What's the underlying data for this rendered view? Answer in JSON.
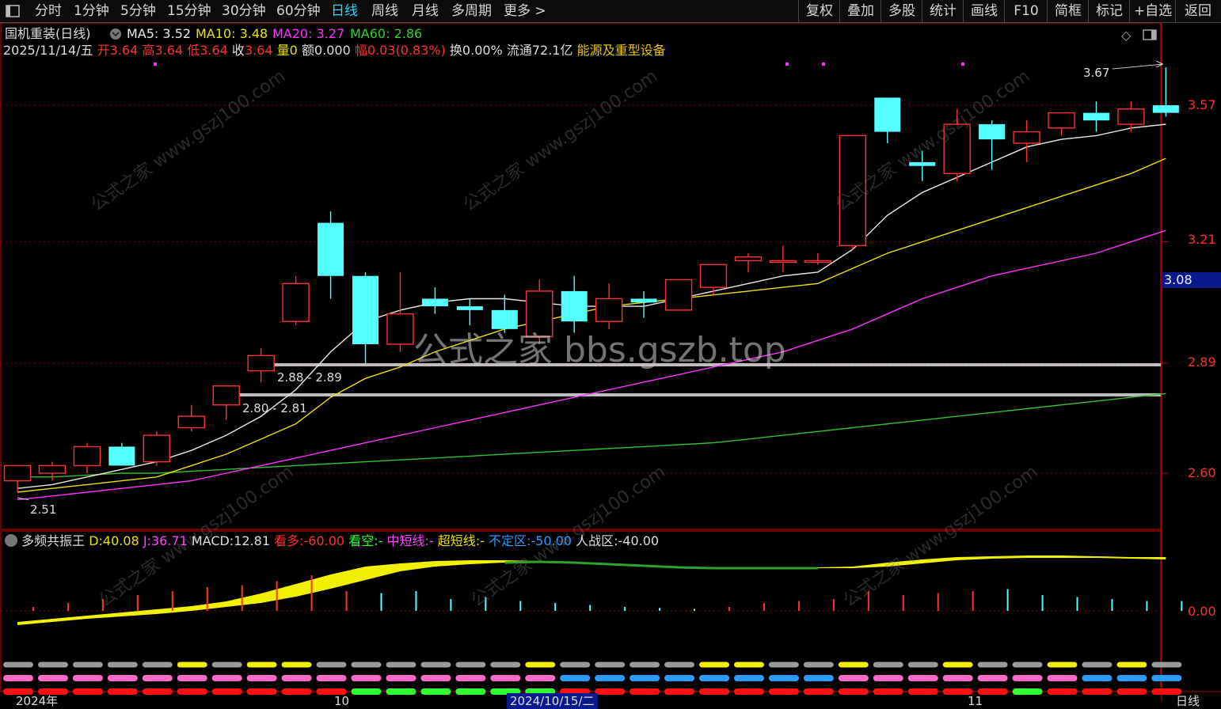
{
  "toolbar": {
    "periods": [
      "分时",
      "1分钟",
      "5分钟",
      "15分钟",
      "30分钟",
      "60分钟",
      "日线",
      "周线",
      "月线",
      "多周期",
      "更多"
    ],
    "active_period": "日线",
    "right": [
      "复权",
      "叠加",
      "多股",
      "统计",
      "画线",
      "F10",
      "简框",
      "标记",
      "+自选",
      "返回"
    ]
  },
  "stock": {
    "title": "国机重装(日线)",
    "ma5_label": "MA5:",
    "ma5": "3.52",
    "ma10_label": "MA10:",
    "ma10": "3.48",
    "ma20_label": "MA20:",
    "ma20": "3.27",
    "ma60_label": "MA60:",
    "ma60": "2.86"
  },
  "quote": {
    "date": "2025/11/14/五",
    "open_label": "开",
    "open": "3.64",
    "high_label": "高",
    "high": "3.64",
    "low_label": "低",
    "low": "3.64",
    "close_label": "收",
    "close": "3.64",
    "vol_label": "量",
    "vol": "0",
    "amount_label": "额",
    "amount": "0.000",
    "change_label": "幅",
    "change": "0.03(0.83%)",
    "turnover": "换0.00%",
    "float": "流通72.1亿",
    "industry": "能源及重型设备"
  },
  "price_axis": [
    "3.57",
    "3.21",
    "2.89",
    "2.60"
  ],
  "current_price": "3.08",
  "annotations": {
    "high_label": "3.67",
    "low_label": "2.51",
    "zone1": "2.88 - 2.89",
    "zone2": "2.80 - 2.81"
  },
  "watermark_center": "公式之家 bbs.gszb.top",
  "watermark_tile": "公式之家 www.gszj100.com",
  "indicator": {
    "name": "多频共振王",
    "d_label": "D:",
    "d": "40.08",
    "j_label": "J:",
    "j": "36.71",
    "macd_label": "MACD:",
    "macd": "12.81",
    "bull_label": "看多:",
    "bull": "-60.00",
    "bear_label": "看空:",
    "bear": "-",
    "mid_label": "中短线:",
    "mid": "-",
    "short_label": "超短线:",
    "short": "-",
    "uncertain_label": "不定区:",
    "uncertain": "-50.00",
    "battle_label": "人战区:",
    "battle": "-40.00",
    "axis": "0.00"
  },
  "bottom": {
    "year": "2024年",
    "m1": "10",
    "date_box": "2024/10/15/二",
    "m2": "11",
    "period": "日线"
  },
  "colors": {
    "up": "#ff3030",
    "down": "#54ffff",
    "ma5": "#e8e8e8",
    "ma10": "#e8e000",
    "ma20": "#ff30ff",
    "ma60": "#30c030"
  },
  "chart_data": {
    "type": "candlestick",
    "candles": [
      {
        "o": 2.58,
        "h": 2.62,
        "l": 2.55,
        "c": 2.62
      },
      {
        "o": 2.6,
        "h": 2.63,
        "l": 2.58,
        "c": 2.62
      },
      {
        "o": 2.62,
        "h": 2.68,
        "l": 2.6,
        "c": 2.67
      },
      {
        "o": 2.67,
        "h": 2.68,
        "l": 2.62,
        "c": 2.62
      },
      {
        "o": 2.63,
        "h": 2.71,
        "l": 2.62,
        "c": 2.7
      },
      {
        "o": 2.72,
        "h": 2.78,
        "l": 2.71,
        "c": 2.75
      },
      {
        "o": 2.78,
        "h": 2.83,
        "l": 2.74,
        "c": 2.83
      },
      {
        "o": 2.87,
        "h": 2.93,
        "l": 2.84,
        "c": 2.91
      },
      {
        "o": 3.0,
        "h": 3.12,
        "l": 2.99,
        "c": 3.1
      },
      {
        "o": 3.26,
        "h": 3.29,
        "l": 3.06,
        "c": 3.12
      },
      {
        "o": 3.12,
        "h": 3.13,
        "l": 2.89,
        "c": 2.94
      },
      {
        "o": 2.94,
        "h": 3.13,
        "l": 2.92,
        "c": 3.02
      },
      {
        "o": 3.06,
        "h": 3.09,
        "l": 3.02,
        "c": 3.04
      },
      {
        "o": 3.04,
        "h": 3.06,
        "l": 2.99,
        "c": 3.03
      },
      {
        "o": 3.03,
        "h": 3.07,
        "l": 2.97,
        "c": 2.98
      },
      {
        "o": 2.96,
        "h": 3.11,
        "l": 2.94,
        "c": 3.08
      },
      {
        "o": 3.08,
        "h": 3.12,
        "l": 2.97,
        "c": 3.0
      },
      {
        "o": 3.0,
        "h": 3.1,
        "l": 2.98,
        "c": 3.06
      },
      {
        "o": 3.06,
        "h": 3.08,
        "l": 3.01,
        "c": 3.05
      },
      {
        "o": 3.03,
        "h": 3.11,
        "l": 3.03,
        "c": 3.11
      },
      {
        "o": 3.09,
        "h": 3.15,
        "l": 3.07,
        "c": 3.15
      },
      {
        "o": 3.16,
        "h": 3.18,
        "l": 3.13,
        "c": 3.17
      },
      {
        "o": 3.16,
        "h": 3.2,
        "l": 3.13,
        "c": 3.16
      },
      {
        "o": 3.16,
        "h": 3.18,
        "l": 3.15,
        "c": 3.16
      },
      {
        "o": 3.2,
        "h": 3.49,
        "l": 3.19,
        "c": 3.49
      },
      {
        "o": 3.59,
        "h": 3.59,
        "l": 3.47,
        "c": 3.5
      },
      {
        "o": 3.42,
        "h": 3.45,
        "l": 3.37,
        "c": 3.41
      },
      {
        "o": 3.39,
        "h": 3.56,
        "l": 3.37,
        "c": 3.52
      },
      {
        "o": 3.52,
        "h": 3.53,
        "l": 3.4,
        "c": 3.48
      },
      {
        "o": 3.47,
        "h": 3.53,
        "l": 3.42,
        "c": 3.5
      },
      {
        "o": 3.51,
        "h": 3.55,
        "l": 3.49,
        "c": 3.55
      },
      {
        "o": 3.55,
        "h": 3.58,
        "l": 3.5,
        "c": 3.53
      },
      {
        "o": 3.52,
        "h": 3.58,
        "l": 3.5,
        "c": 3.56
      },
      {
        "o": 3.57,
        "h": 3.67,
        "l": 3.54,
        "c": 3.55
      }
    ],
    "ma5": [
      2.56,
      2.57,
      2.59,
      2.61,
      2.63,
      2.66,
      2.7,
      2.75,
      2.82,
      2.92,
      3.0,
      3.03,
      3.05,
      3.06,
      3.06,
      3.05,
      3.04,
      3.04,
      3.04,
      3.06,
      3.08,
      3.1,
      3.12,
      3.13,
      3.19,
      3.28,
      3.34,
      3.38,
      3.42,
      3.46,
      3.48,
      3.49,
      3.51,
      3.52
    ],
    "ma10": [
      2.55,
      2.56,
      2.57,
      2.58,
      2.59,
      2.62,
      2.65,
      2.69,
      2.73,
      2.8,
      2.85,
      2.88,
      2.92,
      2.95,
      2.98,
      3.0,
      3.02,
      3.04,
      3.05,
      3.06,
      3.07,
      3.08,
      3.09,
      3.1,
      3.14,
      3.18,
      3.21,
      3.24,
      3.27,
      3.3,
      3.33,
      3.36,
      3.39,
      3.43
    ],
    "ma20": [
      2.53,
      2.54,
      2.55,
      2.56,
      2.57,
      2.58,
      2.6,
      2.62,
      2.64,
      2.66,
      2.68,
      2.7,
      2.72,
      2.74,
      2.76,
      2.78,
      2.8,
      2.82,
      2.84,
      2.86,
      2.88,
      2.9,
      2.92,
      2.95,
      2.98,
      3.02,
      3.06,
      3.09,
      3.12,
      3.14,
      3.16,
      3.18,
      3.21,
      3.24
    ],
    "ma60": [
      2.59,
      2.59,
      2.595,
      2.6,
      2.6,
      2.605,
      2.61,
      2.615,
      2.62,
      2.625,
      2.63,
      2.635,
      2.64,
      2.645,
      2.65,
      2.655,
      2.66,
      2.665,
      2.67,
      2.675,
      2.68,
      2.69,
      2.7,
      2.71,
      2.72,
      2.73,
      2.74,
      2.75,
      2.76,
      2.77,
      2.78,
      2.79,
      2.8,
      2.81
    ],
    "macd_bars": [
      0.2,
      0.4,
      0.6,
      0.8,
      1.0,
      1.2,
      1.3,
      1.5,
      1.8,
      1.0,
      -0.9,
      -1.0,
      -0.6,
      -0.7,
      -0.5,
      -0.4,
      -0.3,
      -0.2,
      -0.15,
      -0.1,
      0.2,
      0.4,
      0.5,
      0.6,
      1.0,
      0.8,
      0.9,
      1.0,
      -1.1,
      -0.8,
      -0.7,
      -0.6,
      -0.5,
      -0.5
    ],
    "pattern_rows": [
      [
        "gray",
        "gray",
        "gray",
        "gray",
        "gray",
        "yellow",
        "gray",
        "yellow",
        "yellow",
        "gray",
        "gray",
        "gray",
        "gray",
        "gray",
        "gray",
        "yellow",
        "gray",
        "gray",
        "gray",
        "gray",
        "yellow",
        "yellow",
        "gray",
        "gray",
        "yellow",
        "gray",
        "gray",
        "yellow",
        "gray",
        "gray",
        "yellow",
        "gray",
        "yellow",
        "gray"
      ],
      [
        "pink",
        "pink",
        "pink",
        "pink",
        "pink",
        "pink",
        "pink",
        "pink",
        "pink",
        "pink",
        "pink",
        "pink",
        "pink",
        "pink",
        "pink",
        "pink",
        "blue",
        "blue",
        "blue",
        "blue",
        "blue",
        "blue",
        "blue",
        "blue",
        "pink",
        "pink",
        "pink",
        "pink",
        "pink",
        "pink",
        "pink",
        "blue",
        "blue",
        "blue"
      ],
      [
        "red",
        "red",
        "red",
        "red",
        "red",
        "red",
        "red",
        "red",
        "red",
        "red",
        "green",
        "green",
        "green",
        "green",
        "green",
        "green",
        "red",
        "red",
        "red",
        "red",
        "red",
        "red",
        "red",
        "red",
        "red",
        "red",
        "red",
        "red",
        "red",
        "green",
        "red",
        "red",
        "red",
        "red"
      ]
    ]
  }
}
